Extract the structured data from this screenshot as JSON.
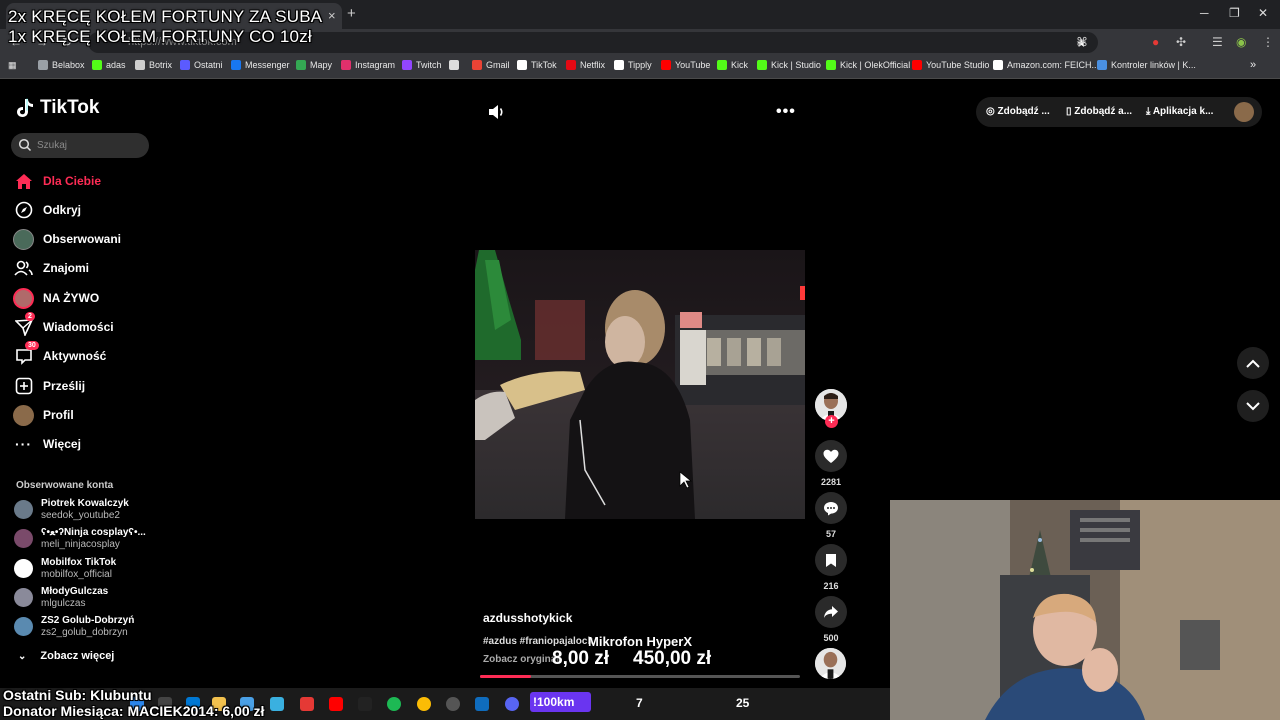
{
  "stream_overlay": {
    "line1": "2x KRĘCĘ KOŁEM FORTUNY ZA SUBA",
    "line2": "1x KRĘCĘ KOŁEM FORTUNY CO 10zł",
    "last_sub": "Ostatni Sub: Klubuntu",
    "donator": "Donator Miesiąca: MACIEK2014: 6,00 zł"
  },
  "browser": {
    "tab_close": "×",
    "tab_add": "+",
    "url": "https://www.tiktok.com",
    "bookmarks": [
      {
        "label": "Belabox",
        "icon": "belabox-icon",
        "color": "#9aa0a6"
      },
      {
        "label": "adas",
        "icon": "kick-icon",
        "color": "#53fc18"
      },
      {
        "label": "Botrix",
        "icon": "botrix-icon",
        "color": "#cfcfcf"
      },
      {
        "label": "Ostatni",
        "icon": "ostatni-icon",
        "color": "#5b5bff"
      },
      {
        "label": "Messenger",
        "icon": "facebook-icon",
        "color": "#1877f2"
      },
      {
        "label": "Mapy",
        "icon": "maps-icon",
        "color": "#34a853"
      },
      {
        "label": "Instagram",
        "icon": "instagram-icon",
        "color": "#e1306c"
      },
      {
        "label": "Twitch",
        "icon": "twitch-icon",
        "color": "#9146ff"
      },
      {
        "label": "",
        "icon": "globe-icon",
        "color": "#dddddd"
      },
      {
        "label": "Gmail",
        "icon": "gmail-icon",
        "color": "#ea4335"
      },
      {
        "label": "TikTok",
        "icon": "tiktok-icon",
        "color": "#ffffff"
      },
      {
        "label": "Netflix",
        "icon": "netflix-icon",
        "color": "#e50914"
      },
      {
        "label": "Tipply",
        "icon": "tipply-icon",
        "color": "#ffffff"
      },
      {
        "label": "YouTube",
        "icon": "youtube-icon",
        "color": "#ff0000"
      },
      {
        "label": "Kick",
        "icon": "kick-icon",
        "color": "#53fc18"
      },
      {
        "label": "Kick | Studio",
        "icon": "kick-icon",
        "color": "#53fc18"
      },
      {
        "label": "Kick | OlekOfficial",
        "icon": "kick-icon",
        "color": "#53fc18"
      },
      {
        "label": "YouTube Studio",
        "icon": "youtube-icon",
        "color": "#ff0000"
      },
      {
        "label": "Amazon.com: FEICH...",
        "icon": "amazon-icon",
        "color": "#ffffff"
      },
      {
        "label": "Kontroler linków | K...",
        "icon": "link-icon",
        "color": "#4a90e2"
      }
    ],
    "more_bookmarks": "»"
  },
  "tiktok": {
    "logo": "TikTok",
    "search_placeholder": "Szukaj",
    "nav": [
      {
        "label": "Dla Ciebie",
        "icon": "home-icon"
      },
      {
        "label": "Odkryj",
        "icon": "compass-icon"
      },
      {
        "label": "Obserwowani",
        "icon": "following-avatar"
      },
      {
        "label": "Znajomi",
        "icon": "friends-icon"
      },
      {
        "label": "NA ŻYWO",
        "icon": "live-avatar"
      },
      {
        "label": "Wiadomości",
        "icon": "messages-icon",
        "badge": "2"
      },
      {
        "label": "Aktywność",
        "icon": "activity-icon",
        "badge": "30"
      },
      {
        "label": "Prześlij",
        "icon": "upload-icon"
      },
      {
        "label": "Profil",
        "icon": "profile-avatar"
      },
      {
        "label": "Więcej",
        "icon": "more-icon"
      }
    ],
    "followed_title": "Obserwowane konta",
    "followed": [
      {
        "name": "Piotrek Kowalczyk",
        "user": "seedok_youtube2",
        "color": "#6a7a8a"
      },
      {
        "name": "ʕ•ﻌ•ʔNinja cosplayʕ•...",
        "user": "meli_ninjacosplay",
        "color": "#7a4a6a"
      },
      {
        "name": "Mobilfox TikTok",
        "user": "mobilfox_official",
        "color": "#ffffff"
      },
      {
        "name": "MłodyGulczas",
        "user": "mlgulczas",
        "color": "#8a8a9a"
      },
      {
        "name": "ZS2 Golub-Dobrzyń",
        "user": "zs2_golub_dobrzyn",
        "color": "#5a8ab0"
      }
    ],
    "see_more": "Zobacz więcej",
    "header": {
      "btn1": "Zdobądź ...",
      "btn2": "Zdobądź a...",
      "btn3": "Aplikacja k..."
    },
    "video": {
      "author": "azdusshotykick",
      "tags": "#azdus #franiopajalock",
      "see_original": "Zobacz oryginał",
      "progress": 0.16,
      "likes": "2281",
      "comments": "57",
      "saves": "216",
      "shares": "500"
    },
    "promo": {
      "title": "Mikrofon HyperX",
      "price": "8,00 zł",
      "old_price": "450,00 zł"
    }
  },
  "taskbar": {
    "chip": "!100km",
    "count1": "7",
    "count2": "25"
  }
}
